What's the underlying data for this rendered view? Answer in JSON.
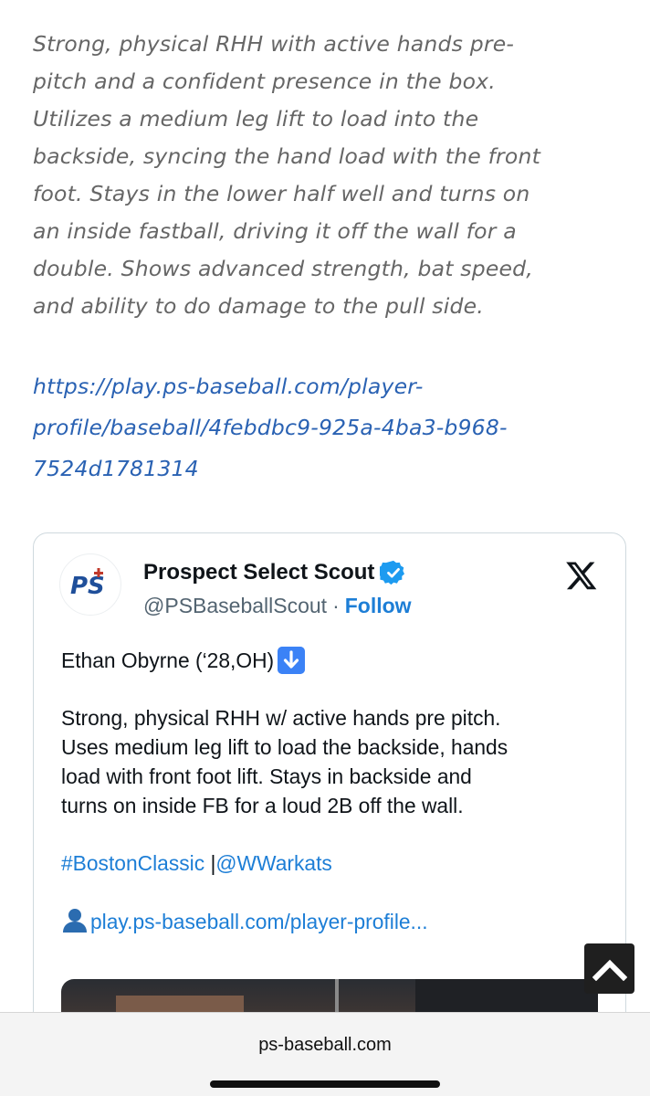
{
  "article": {
    "lines": [
      "Strong, physical RHH with active hands pre-",
      "pitch and a confident presence in the box.",
      "Utilizes a medium leg lift to load into the",
      "backside, syncing the hand load with the front",
      "foot. Stays in the lower half well and turns on",
      "an inside fastball, driving it off the wall for a",
      "double. Shows advanced strength, bat speed,",
      "and ability to do damage to the pull side."
    ],
    "link_lines": [
      "https://play.ps-baseball.com/player-",
      "profile/baseball/4febdbc9-925a-4ba3-b968-",
      "7524d1781314"
    ]
  },
  "tweet": {
    "author_name": "Prospect Select Scout",
    "handle": "@PSBaseballScout",
    "separator": "·",
    "follow_label": "Follow",
    "avatar_text": "PS",
    "title": "Ethan Obyrne (‘28,OH)",
    "body_lines": [
      "Strong, physical RHH w/ active hands pre pitch.",
      "Uses medium leg lift to load the backside, hands",
      "load with front foot lift. Stays in backside and",
      "turns on inside FB for a loud 2B off the wall."
    ],
    "hashtag": "#BostonClassic",
    "pipe": " |",
    "mention": "@WWarkats",
    "link_text": "play.ps-baseball.com/player-profile..."
  },
  "browser": {
    "url": "ps-baseball.com"
  },
  "colors": {
    "article_text": "#666666",
    "article_link": "#2a62b3",
    "tweet_link": "#1d7ed6",
    "verified": "#1d9bf0"
  },
  "icons": {
    "verified": "verified-badge-icon",
    "x_logo": "x-logo-icon",
    "down_arrow": "down-arrow-emoji-icon",
    "person": "person-silhouette-icon",
    "scroll_top": "chevron-up-icon"
  }
}
